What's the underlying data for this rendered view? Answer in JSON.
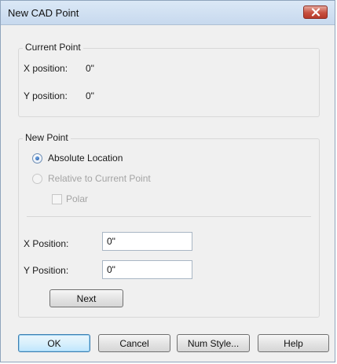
{
  "window": {
    "title": "New CAD Point"
  },
  "current_point": {
    "group_label": "Current Point",
    "x_label": "X position:",
    "x_value": "0\"",
    "y_label": "Y position:",
    "y_value": "0\""
  },
  "new_point": {
    "group_label": "New Point",
    "absolute_label": "Absolute Location",
    "absolute_selected": true,
    "relative_label": "Relative to Current Point",
    "relative_enabled": false,
    "polar_label": "Polar",
    "polar_checked": false,
    "x_label": "X Position:",
    "x_value": "0\"",
    "y_label": "Y Position:",
    "y_value": "0\"",
    "next_label": "Next"
  },
  "buttons": {
    "ok": "OK",
    "cancel": "Cancel",
    "num_style": "Num Style...",
    "help": "Help"
  },
  "icons": {
    "close": "close-icon",
    "radio_selected": "radio-dot-icon"
  }
}
